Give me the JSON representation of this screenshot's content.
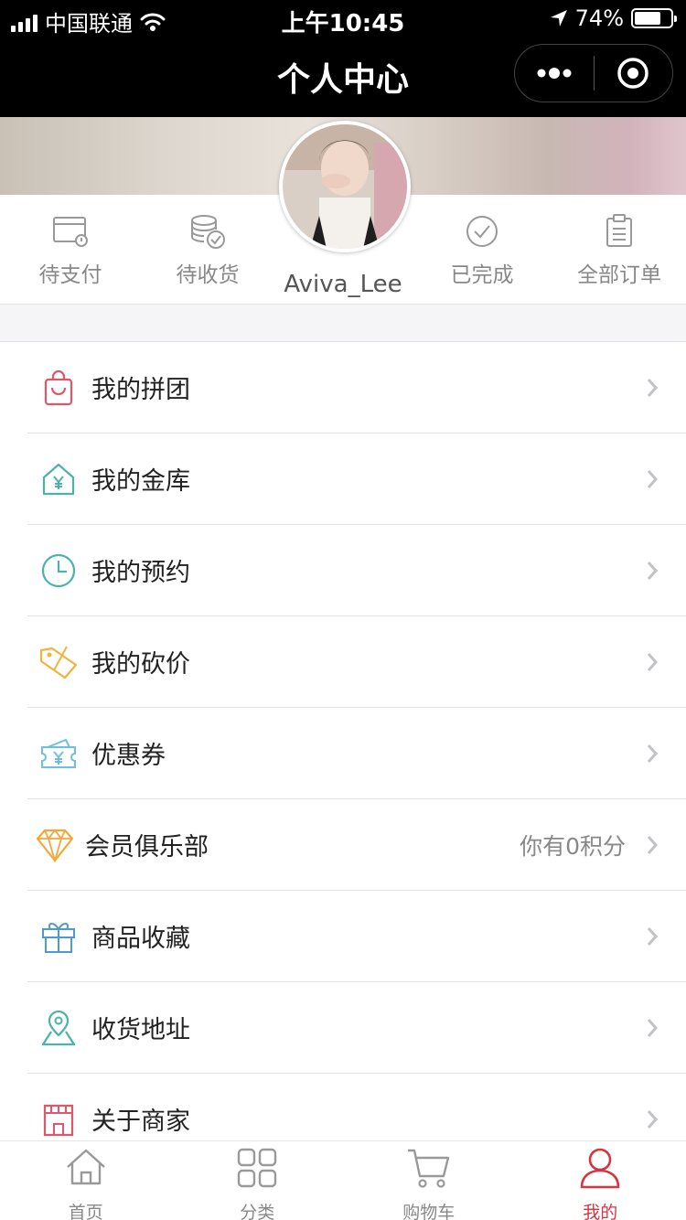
{
  "status_bar": {
    "carrier": "中国联通",
    "time": "上午10:45",
    "battery": "74%",
    "battery_level": 0.74
  },
  "nav": {
    "title": "个人中心"
  },
  "profile": {
    "username": "Aviva_Lee",
    "order_shortcuts": [
      {
        "label": "待支付",
        "icon": "wallet-alert-icon"
      },
      {
        "label": "待收货",
        "icon": "coins-check-icon"
      },
      {
        "label": "已完成",
        "icon": "check-circle-icon"
      },
      {
        "label": "全部订单",
        "icon": "clipboard-icon"
      }
    ]
  },
  "menu": {
    "items": [
      {
        "label": "我的拼团",
        "icon": "shopping-bag-icon",
        "color": "#e0566a"
      },
      {
        "label": "我的金库",
        "icon": "house-yen-icon",
        "color": "#4bb3a7"
      },
      {
        "label": "我的预约",
        "icon": "clock-icon",
        "color": "#4bb3a7"
      },
      {
        "label": "我的砍价",
        "icon": "price-tag-icon",
        "color": "#f0b43c"
      },
      {
        "label": "优惠券",
        "icon": "coupon-icon",
        "color": "#6cc0dc"
      },
      {
        "label": "会员俱乐部",
        "icon": "diamond-icon",
        "color": "#f0a83c",
        "extra": "你有0积分"
      },
      {
        "label": "商品收藏",
        "icon": "gift-icon",
        "color": "#4e9ad6"
      },
      {
        "label": "收货地址",
        "icon": "map-pin-icon",
        "color": "#4bb3a7"
      },
      {
        "label": "关于商家",
        "icon": "store-icon",
        "color": "#e0566a"
      }
    ]
  },
  "tabbar": {
    "tabs": [
      {
        "label": "首页",
        "icon": "home-icon",
        "active": false
      },
      {
        "label": "分类",
        "icon": "grid-icon",
        "active": false
      },
      {
        "label": "购物车",
        "icon": "cart-icon",
        "active": false
      },
      {
        "label": "我的",
        "icon": "user-icon",
        "active": true
      }
    ],
    "active_color": "#d9333f"
  }
}
